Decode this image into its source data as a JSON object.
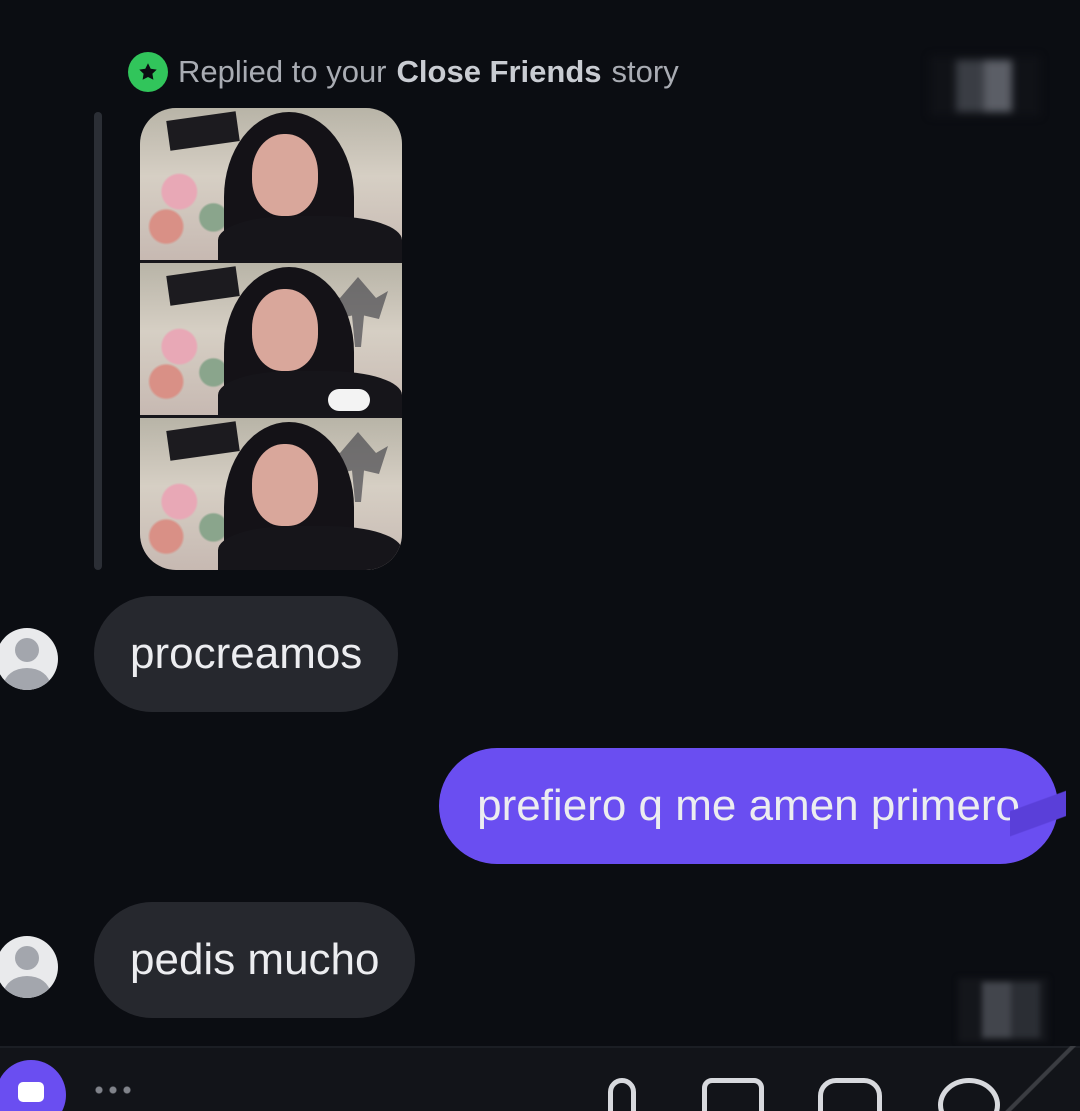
{
  "reply_header": {
    "prefix": "Replied to your",
    "audience": "Close Friends",
    "suffix": "story",
    "icon": "star-icon",
    "accent_color": "#31c55b"
  },
  "messages": [
    {
      "sender": "them",
      "text": "procreamos"
    },
    {
      "sender": "me",
      "text": "prefiero q me amen primero"
    },
    {
      "sender": "them",
      "text": "pedis mucho"
    }
  ],
  "composer": {
    "camera_icon": "camera-icon",
    "mic_icon": "microphone-icon",
    "gallery_icon": "gallery-icon",
    "sticker_icon": "sticker-icon",
    "plus_icon": "plus-icon",
    "accent_color": "#6a4ef1"
  },
  "colors": {
    "background": "#0b0d12",
    "incoming_bubble": "#26282e",
    "outgoing_bubble": "#6a4ef1"
  }
}
